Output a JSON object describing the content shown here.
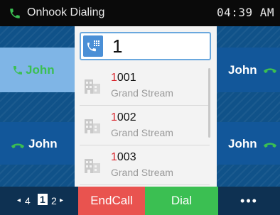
{
  "status_bar": {
    "title": "Onhook Dialing",
    "time": "04:39 AM"
  },
  "left_keys": [
    {
      "label": "John",
      "state": "active"
    },
    {
      "label": "John",
      "state": "idle"
    }
  ],
  "right_keys": [
    {
      "label": "John"
    },
    {
      "label": "John"
    }
  ],
  "dial_input": {
    "value": "1"
  },
  "suggestions": [
    {
      "first": "1",
      "rest": "001",
      "account": "Grand Stream"
    },
    {
      "first": "1",
      "rest": "002",
      "account": "Grand Stream"
    },
    {
      "first": "1",
      "rest": "003",
      "account": "Grand Stream"
    }
  ],
  "pager": {
    "prev": "◂",
    "left_num": "4",
    "current": "1",
    "next_num": "2",
    "next": "▸"
  },
  "softkeys": {
    "end_call": "EndCall",
    "dial": "Dial",
    "more": "•••"
  },
  "colors": {
    "accent_green": "#3bbf52",
    "end_red": "#e9534f",
    "dial_blue": "#4a8fd6"
  },
  "icons": {
    "status": "phone-icon",
    "input": "dialpad-icon",
    "entry": "building-icon",
    "line": "handset-icon"
  }
}
